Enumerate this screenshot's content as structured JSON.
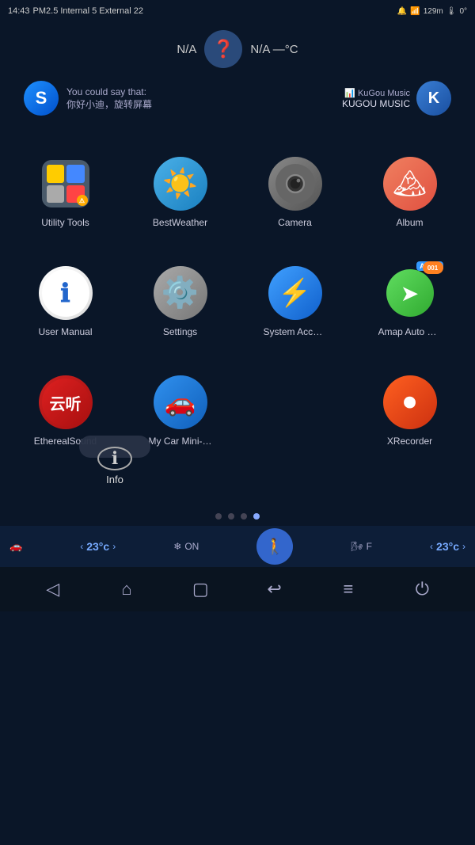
{
  "statusBar": {
    "time": "14:43",
    "mediaInfo": "PM2.5 Internal 5 External 22",
    "batteryInfo": "129m",
    "tempIcon": "🔔"
  },
  "weather": {
    "left": "N/A",
    "right": "N/A —°C",
    "icon": "❓"
  },
  "voice": {
    "prompt": "You could say that:",
    "command": "你好小迪，旋转屏幕",
    "iconLetter": "S"
  },
  "music": {
    "barIcon": "📊",
    "appName": "KuGou Music",
    "appLabel": "KUGOU MUSIC",
    "iconLetter": "K"
  },
  "apps": {
    "row1": [
      {
        "id": "utility-tools",
        "label": "Utility Tools",
        "iconType": "utility"
      },
      {
        "id": "best-weather",
        "label": "BestWeather",
        "iconType": "weather",
        "icon": "🌤"
      },
      {
        "id": "camera",
        "label": "Camera",
        "iconType": "camera",
        "icon": "📷"
      },
      {
        "id": "album",
        "label": "Album",
        "iconType": "album",
        "icon": "🖼"
      }
    ],
    "row2": [
      {
        "id": "user-manual",
        "label": "User Manual",
        "iconType": "manual",
        "icon": "ℹ"
      },
      {
        "id": "settings",
        "label": "Settings",
        "iconType": "settings",
        "icon": "⚙"
      },
      {
        "id": "system-accel",
        "label": "System Accelerati...",
        "iconType": "accel",
        "icon": "⚡"
      },
      {
        "id": "amap-auto",
        "label": "Amap Auto Custom",
        "iconType": "amap",
        "icon": "🗺",
        "badge": "001"
      }
    ],
    "row3": [
      {
        "id": "ethereal-sound",
        "label": "EtherealSound",
        "iconType": "ethereal",
        "icon": "云"
      },
      {
        "id": "my-car",
        "label": "My Car Mini-App",
        "iconType": "mycar",
        "icon": "🚗"
      },
      {
        "id": "empty",
        "label": "",
        "iconType": "none"
      },
      {
        "id": "xrecorder",
        "label": "XRecorder",
        "iconType": "xrecorder",
        "icon": "⏺"
      }
    ]
  },
  "infoPopup": {
    "icon": "ℹ",
    "label": "Info"
  },
  "pageDots": [
    {
      "active": false
    },
    {
      "active": false
    },
    {
      "active": false
    },
    {
      "active": true
    }
  ],
  "bottomControls": {
    "leftTemp": "23°c",
    "rightTemp": "23°c",
    "fanLabel": "ON",
    "heatLabel": "F"
  },
  "navBar": {
    "back": "◁",
    "home": "⌂",
    "recent": "□",
    "share": "↩",
    "menu": "≡",
    "power": "⏻"
  }
}
